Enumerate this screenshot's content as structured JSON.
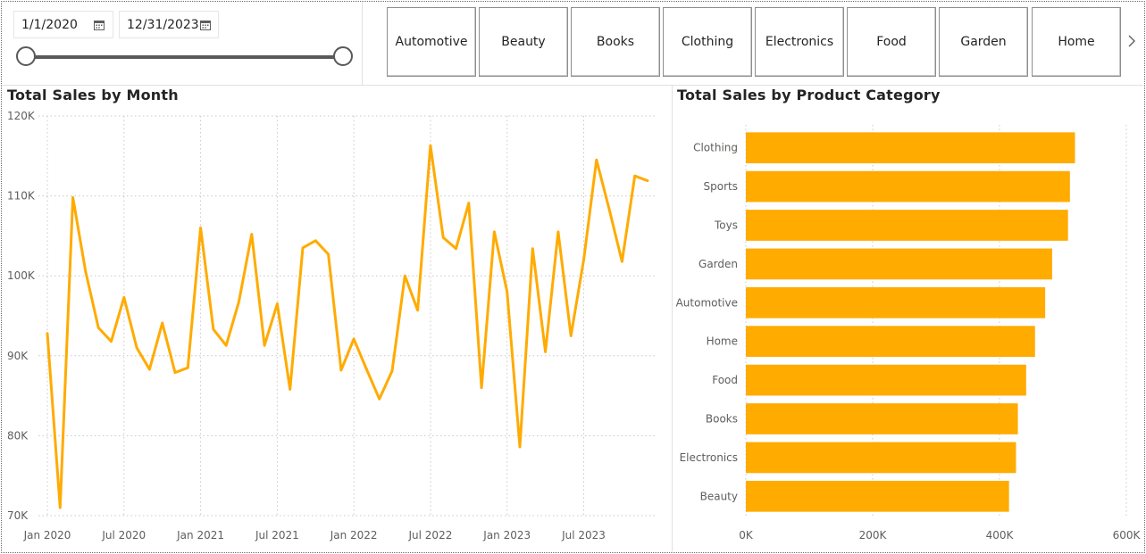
{
  "slicer": {
    "start_date": "1/1/2020",
    "end_date": "12/31/2023",
    "calendar_icon": "calendar-icon",
    "range_fraction": [
      0,
      1
    ]
  },
  "category_tiles": [
    "Automotive",
    "Beauty",
    "Books",
    "Clothing",
    "Electronics",
    "Food",
    "Garden",
    "Home"
  ],
  "colors": {
    "accent": "#FFAB00",
    "grid": "#c8c8c8",
    "text": "#605e5c"
  },
  "chart_data": [
    {
      "type": "line",
      "title": "Total Sales by Month",
      "xlabel": "",
      "ylabel": "",
      "ylim": [
        70000,
        120000
      ],
      "y_ticks": [
        70000,
        80000,
        90000,
        100000,
        110000,
        120000
      ],
      "y_tick_labels": [
        "70K",
        "80K",
        "90K",
        "100K",
        "110K",
        "120K"
      ],
      "x_ticks": [
        "2020-01",
        "2020-07",
        "2021-01",
        "2021-07",
        "2022-01",
        "2022-07",
        "2023-01",
        "2023-07"
      ],
      "x_tick_labels": [
        "Jan 2020",
        "Jul 2020",
        "Jan 2021",
        "Jul 2021",
        "Jan 2022",
        "Jul 2022",
        "Jan 2023",
        "Jul 2023"
      ],
      "grid": true,
      "series": [
        {
          "x": [
            "2020-01",
            "2020-02",
            "2020-03",
            "2020-04",
            "2020-05",
            "2020-06",
            "2020-07",
            "2020-08",
            "2020-09",
            "2020-10",
            "2020-11",
            "2020-12",
            "2021-01",
            "2021-02",
            "2021-03",
            "2021-04",
            "2021-05",
            "2021-06",
            "2021-07",
            "2021-08",
            "2021-09",
            "2021-10",
            "2021-11",
            "2021-12",
            "2022-01",
            "2022-02",
            "2022-03",
            "2022-04",
            "2022-05",
            "2022-06",
            "2022-07",
            "2022-08",
            "2022-09",
            "2022-10",
            "2022-11",
            "2022-12",
            "2023-01",
            "2023-02",
            "2023-03",
            "2023-04",
            "2023-05",
            "2023-06",
            "2023-07",
            "2023-08",
            "2023-09",
            "2023-10",
            "2023-11",
            "2023-12"
          ],
          "values": [
            92800,
            71000,
            109800,
            100500,
            93500,
            91800,
            97300,
            91000,
            88300,
            94100,
            87900,
            88500,
            106000,
            93300,
            91300,
            96800,
            105200,
            91300,
            96500,
            85800,
            103500,
            104400,
            102700,
            88200,
            92100,
            88300,
            84600,
            88100,
            100000,
            95700,
            116300,
            104800,
            103400,
            109100,
            86000,
            105500,
            98000,
            78600,
            103400,
            90500,
            105500,
            92500,
            102000,
            114500,
            108300,
            101800,
            112500,
            111900
          ]
        }
      ]
    },
    {
      "type": "bar",
      "orientation": "horizontal",
      "title": "Total Sales by Product Category",
      "xlabel": "",
      "ylabel": "",
      "xlim": [
        0,
        600000
      ],
      "x_ticks": [
        0,
        200000,
        400000,
        600000
      ],
      "x_tick_labels": [
        "0K",
        "200K",
        "400K",
        "600K"
      ],
      "categories": [
        "Clothing",
        "Sports",
        "Toys",
        "Garden",
        "Automotive",
        "Home",
        "Food",
        "Books",
        "Electronics",
        "Beauty"
      ],
      "values": [
        519000,
        511000,
        508000,
        483000,
        472000,
        456000,
        442000,
        429000,
        426000,
        415000
      ]
    }
  ]
}
